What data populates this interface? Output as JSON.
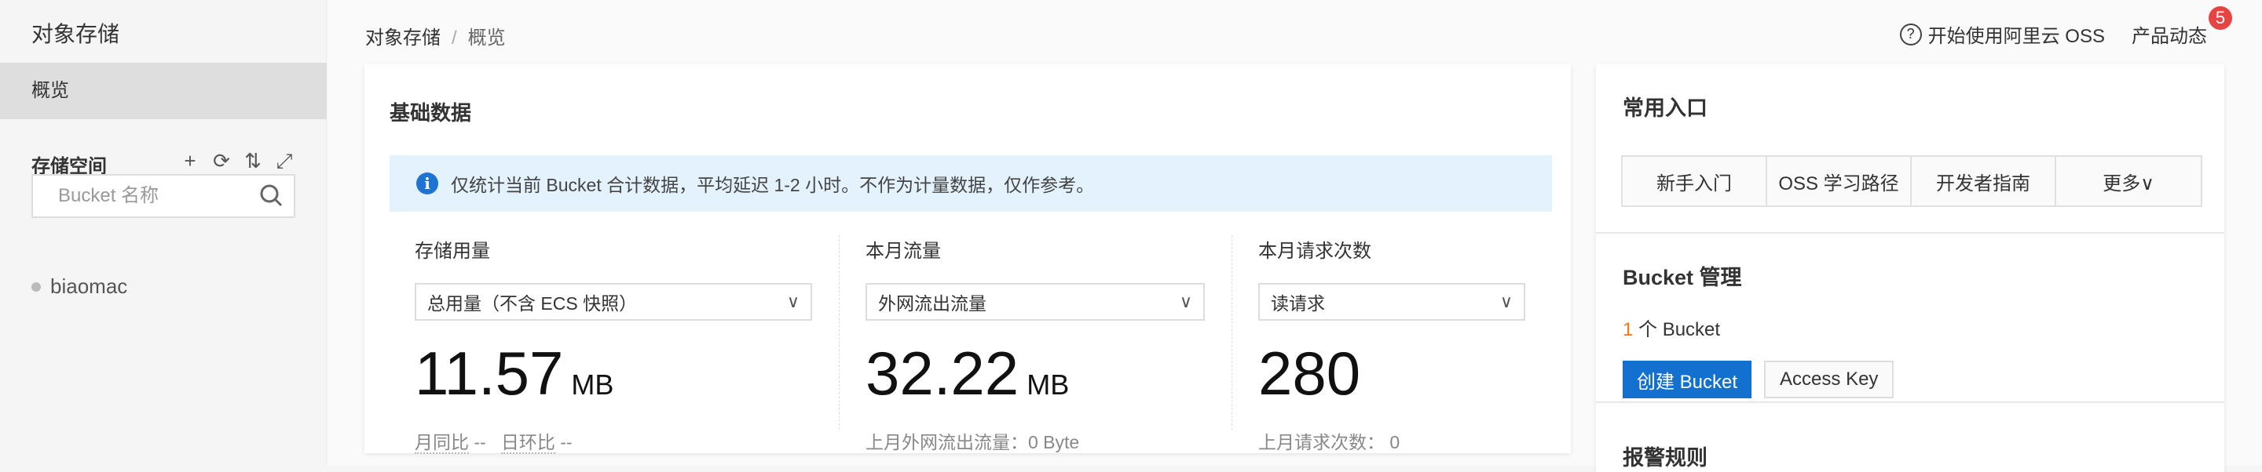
{
  "sidebar": {
    "title": "对象存储",
    "overview": "概览",
    "storage_space": "存储空间",
    "tools": [
      "+",
      "⟳",
      "⇅",
      "⤢"
    ],
    "search_placeholder": "Bucket 名称",
    "buckets": [
      "biaomac"
    ]
  },
  "header": {
    "breadcrumb": [
      "对象存储",
      "概览"
    ],
    "help_link": "开始使用阿里云 OSS",
    "news_link": "产品动态",
    "news_badge": "5"
  },
  "basic": {
    "title": "基础数据",
    "notice": "仅统计当前 Bucket 合计数据，平均延迟 1-2 小时。不作为计量数据，仅作参考。",
    "stats": [
      {
        "label": "存储用量",
        "select": "总用量（不含 ECS 快照）",
        "value": "11.57",
        "unit": "MB",
        "sub1": "月同比",
        "sub1v": "--",
        "sub2": "日环比",
        "sub2v": "--"
      },
      {
        "label": "本月流量",
        "select": "外网流出流量",
        "value": "32.22",
        "unit": "MB",
        "sub": "上月外网流出流量：0 Byte"
      },
      {
        "label": "本月请求次数",
        "select": "读请求",
        "value": "280",
        "unit": "",
        "sub": "上月请求次数：  0"
      }
    ]
  },
  "quick": {
    "title": "常用入口",
    "links": [
      "新手入门",
      "OSS 学习路径",
      "开发者指南",
      "更多∨"
    ]
  },
  "bucket_mgmt": {
    "title": "Bucket 管理",
    "count": "1",
    "count_suffix": " 个 Bucket",
    "create": "创建 Bucket",
    "access_key": "Access Key"
  },
  "alarm": {
    "title": "报警规则"
  },
  "colors": {
    "primary": "#1370cf",
    "badge": "#e84343",
    "count": "#f5761a",
    "notice_bg": "#e3f2fd"
  }
}
